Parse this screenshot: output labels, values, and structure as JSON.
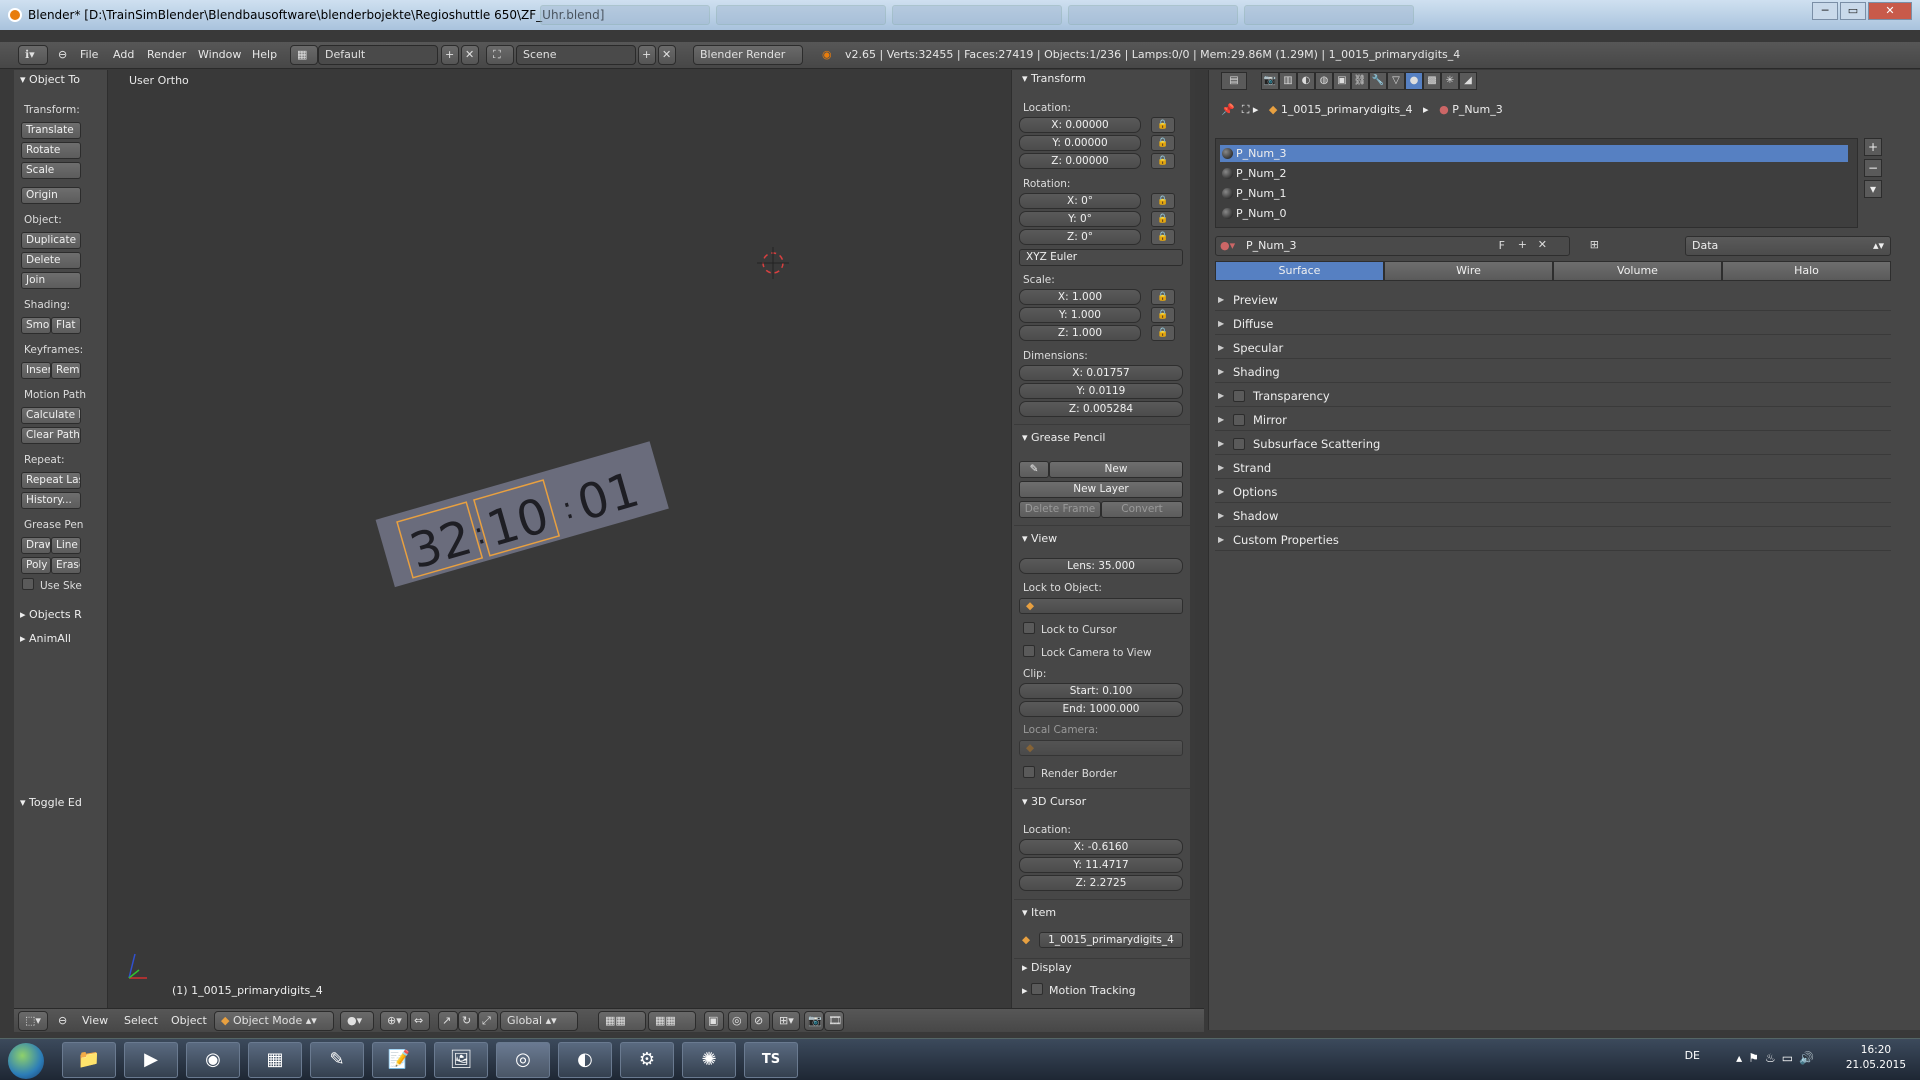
{
  "window": {
    "title": "Blender* [D:\\TrainSimBlender\\Blendbausoftware\\blenderbojekte\\Regioshuttle 650\\ZF_Uhr.blend]",
    "controls": [
      "─",
      "▭",
      "✕"
    ]
  },
  "header": {
    "menus": [
      "File",
      "Add",
      "Render",
      "Window",
      "Help"
    ],
    "screen_layout": "Default",
    "scene": "Scene",
    "render_engine": "Blender Render",
    "stats": "v2.65 | Verts:32455 | Faces:27419 | Objects:1/236 | Lamps:0/0 | Mem:29.86M (1.29M) | 1_0015_primarydigits_4"
  },
  "toolshelf": {
    "title": "Object To",
    "transform_label": "Transform:",
    "translate": "Translate",
    "rotate": "Rotate",
    "scale": "Scale",
    "origin": "Origin",
    "object_label": "Object:",
    "duplicate": "Duplicate O",
    "delete": "Delete",
    "join": "Join",
    "shading_label": "Shading:",
    "smooth": "Smo",
    "flat": "Flat",
    "keyframes_label": "Keyframes:",
    "insert": "Inser",
    "remove": "Rem",
    "motion_path_label": "Motion Path",
    "calculate": "Calculate P",
    "clear_paths": "Clear Paths",
    "repeat_label": "Repeat:",
    "repeat_last": "Repeat Last",
    "history": "History...",
    "grease_label": "Grease Pen",
    "draw": "Draw",
    "line": "Line",
    "poly": "Poly",
    "erase": "Erase",
    "use_sketch": "Use Ske",
    "objects_r": "Objects R",
    "animall": "AnimAll",
    "toggle_ed": "Toggle Ed"
  },
  "viewport": {
    "view_name": "User Ortho",
    "object_label": "(1) 1_0015_primarydigits_4",
    "digits": [
      "32",
      ":",
      "10",
      ":",
      "01"
    ]
  },
  "npanel": {
    "transform_title": "Transform",
    "location_label": "Location:",
    "loc_x": "X: 0.00000",
    "loc_y": "Y: 0.00000",
    "loc_z": "Z: 0.00000",
    "rotation_label": "Rotation:",
    "rot_x": "X: 0°",
    "rot_y": "Y: 0°",
    "rot_z": "Z: 0°",
    "rot_mode": "XYZ Euler",
    "scale_label": "Scale:",
    "scale_x": "X: 1.000",
    "scale_y": "Y: 1.000",
    "scale_z": "Z: 1.000",
    "dimensions_label": "Dimensions:",
    "dim_x": "X: 0.01757",
    "dim_y": "Y: 0.0119",
    "dim_z": "Z: 0.005284",
    "grease_title": "Grease Pencil",
    "gp_new": "New",
    "gp_new_layer": "New Layer",
    "gp_delete_frame": "Delete Frame",
    "gp_convert": "Convert",
    "view_title": "View",
    "lens": "Lens: 35.000",
    "lock_object_label": "Lock to Object:",
    "lock_cursor": "Lock to Cursor",
    "lock_camera": "Lock Camera to View",
    "clip_label": "Clip:",
    "clip_start": "Start: 0.100",
    "clip_end": "End: 1000.000",
    "local_camera_label": "Local Camera:",
    "render_border": "Render Border",
    "cursor_title": "3D Cursor",
    "cursor_location_label": "Location:",
    "cur_x": "X: -0.6160",
    "cur_y": "Y: 11.4717",
    "cur_z": "Z: 2.2725",
    "item_title": "Item",
    "item_name": "1_0015_primarydigits_4",
    "display_title": "Display",
    "motion_tracking_title": "Motion Tracking"
  },
  "properties": {
    "breadcrumb_object": "1_0015_primarydigits_4",
    "breadcrumb_material": "P_Num_3",
    "slots": [
      "P_Num_3",
      "P_Num_2",
      "P_Num_1",
      "P_Num_0"
    ],
    "material_name": "P_Num_3",
    "fake_user": "F",
    "link": "Data",
    "tabs": [
      "Surface",
      "Wire",
      "Volume",
      "Halo"
    ],
    "active_tab": "Surface",
    "panels": [
      {
        "label": "Preview",
        "checkbox": false
      },
      {
        "label": "Diffuse",
        "checkbox": false
      },
      {
        "label": "Specular",
        "checkbox": false
      },
      {
        "label": "Shading",
        "checkbox": false
      },
      {
        "label": "Transparency",
        "checkbox": true
      },
      {
        "label": "Mirror",
        "checkbox": true
      },
      {
        "label": "Subsurface Scattering",
        "checkbox": true
      },
      {
        "label": "Strand",
        "checkbox": false
      },
      {
        "label": "Options",
        "checkbox": false
      },
      {
        "label": "Shadow",
        "checkbox": false
      },
      {
        "label": "Custom Properties",
        "checkbox": false
      }
    ]
  },
  "bottomheader": {
    "menus": [
      "View",
      "Select",
      "Object"
    ],
    "mode": "Object Mode",
    "orientation": "Global"
  },
  "taskbar": {
    "language": "DE",
    "time": "16:20",
    "date": "21.05.2015",
    "ts_label": "TS"
  },
  "colors": {
    "selection_blue": "#5680c2",
    "object_outline": "#e8a040",
    "panel_bg": "#474747",
    "viewport_bg": "#393939"
  }
}
